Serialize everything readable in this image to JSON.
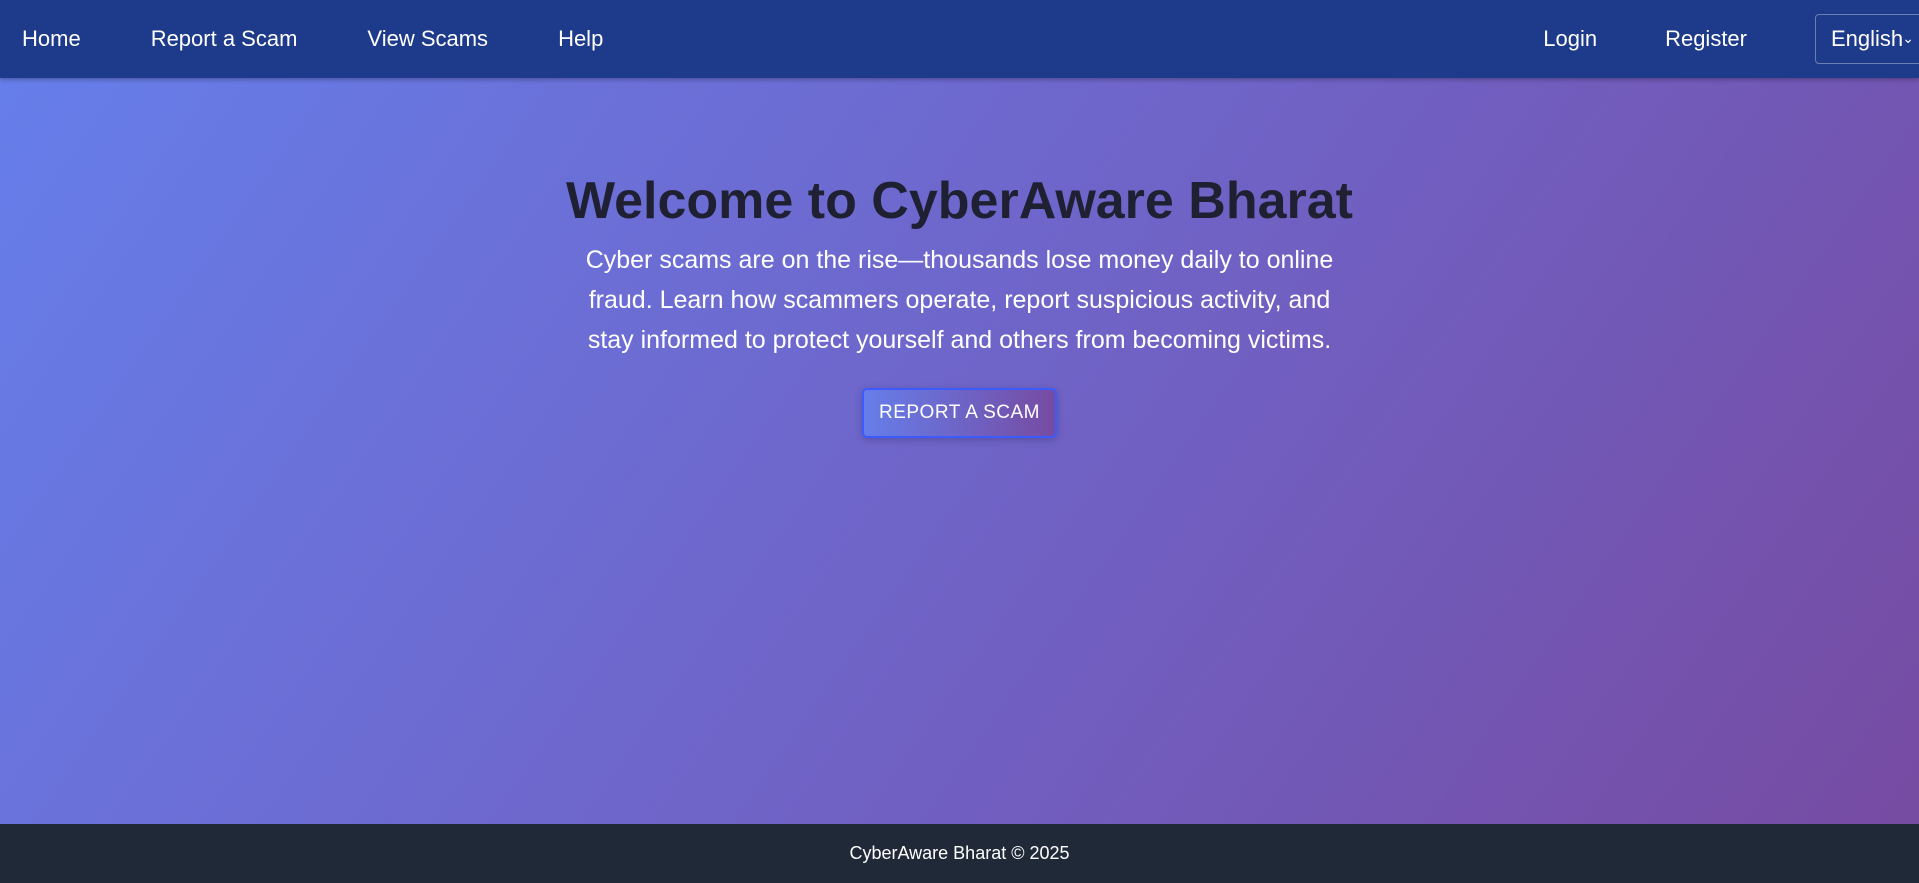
{
  "nav": {
    "links": [
      "Home",
      "Report a Scam",
      "View Scams",
      "Help"
    ],
    "login": "Login",
    "register": "Register",
    "language": "English"
  },
  "hero": {
    "title": "Welcome to CyberAware Bharat",
    "text": "Cyber scams are on the rise—thousands lose money daily to online fraud. Learn how scammers operate, report suspicious activity, and stay informed to protect yourself and others from becoming victims.",
    "button": "REPORT A SCAM"
  },
  "footer": {
    "text": "CyberAware Bharat © 2025"
  },
  "colors": {
    "navbar": "#1e3a8a",
    "gradient_start": "#667eea",
    "gradient_end": "#764ba2",
    "footer": "#1f2937"
  },
  "icons": {
    "language_dropdown": "chevron-down-icon"
  }
}
